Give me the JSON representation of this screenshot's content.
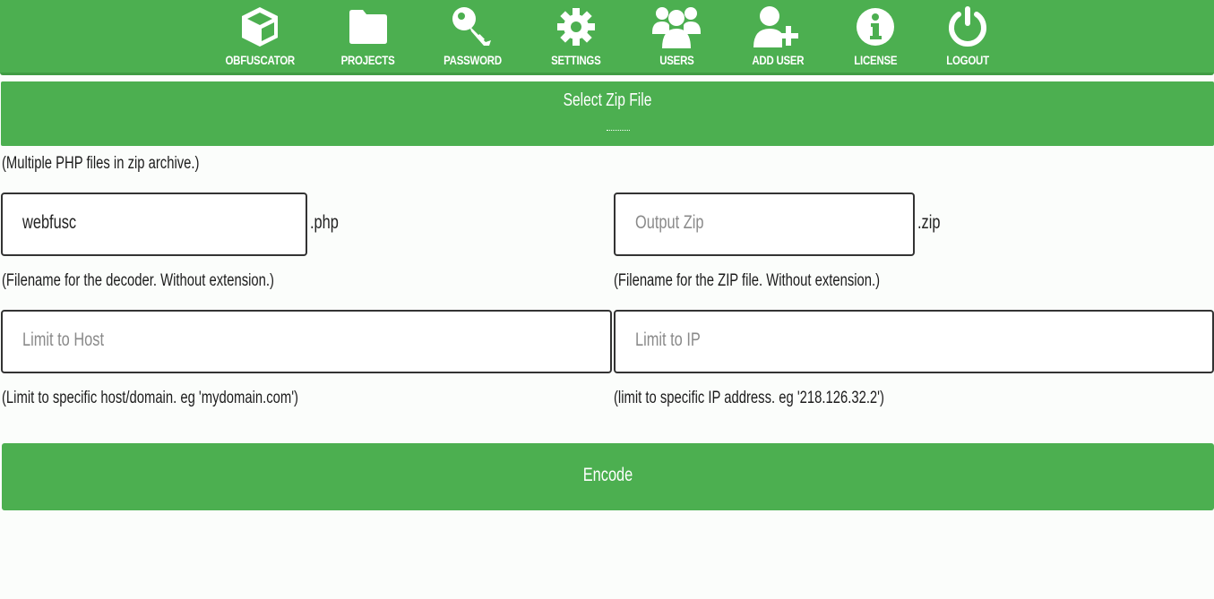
{
  "nav": {
    "items": [
      {
        "label": "OBFUSCATOR",
        "icon": "cube-icon"
      },
      {
        "label": "PROJECTS",
        "icon": "folder-icon"
      },
      {
        "label": "PASSWORD",
        "icon": "key-icon"
      },
      {
        "label": "SETTINGS",
        "icon": "gear-icon"
      },
      {
        "label": "USERS",
        "icon": "users-icon"
      },
      {
        "label": "ADD USER",
        "icon": "add-user-icon"
      },
      {
        "label": "LICENSE",
        "icon": "info-icon"
      },
      {
        "label": "LOGOUT",
        "icon": "power-icon"
      }
    ]
  },
  "zip": {
    "select_label": "Select Zip File",
    "hint": "(Multiple PHP files in zip archive.)"
  },
  "decoder": {
    "value": "webfusc",
    "suffix": ".php",
    "hint": "(Filename for the decoder. Without extension.)"
  },
  "output": {
    "placeholder": "Output Zip",
    "suffix": ".zip",
    "hint": "(Filename for the ZIP file. Without extension.)"
  },
  "host": {
    "placeholder": "Limit to Host",
    "hint": "(Limit to specific host/domain. eg 'mydomain.com')"
  },
  "ip": {
    "placeholder": "Limit to IP",
    "hint": "(limit to specific IP address. eg '218.126.32.2')"
  },
  "encode": {
    "label": "Encode"
  },
  "colors": {
    "accent": "#4caf50",
    "background": "#fbfdfb"
  }
}
